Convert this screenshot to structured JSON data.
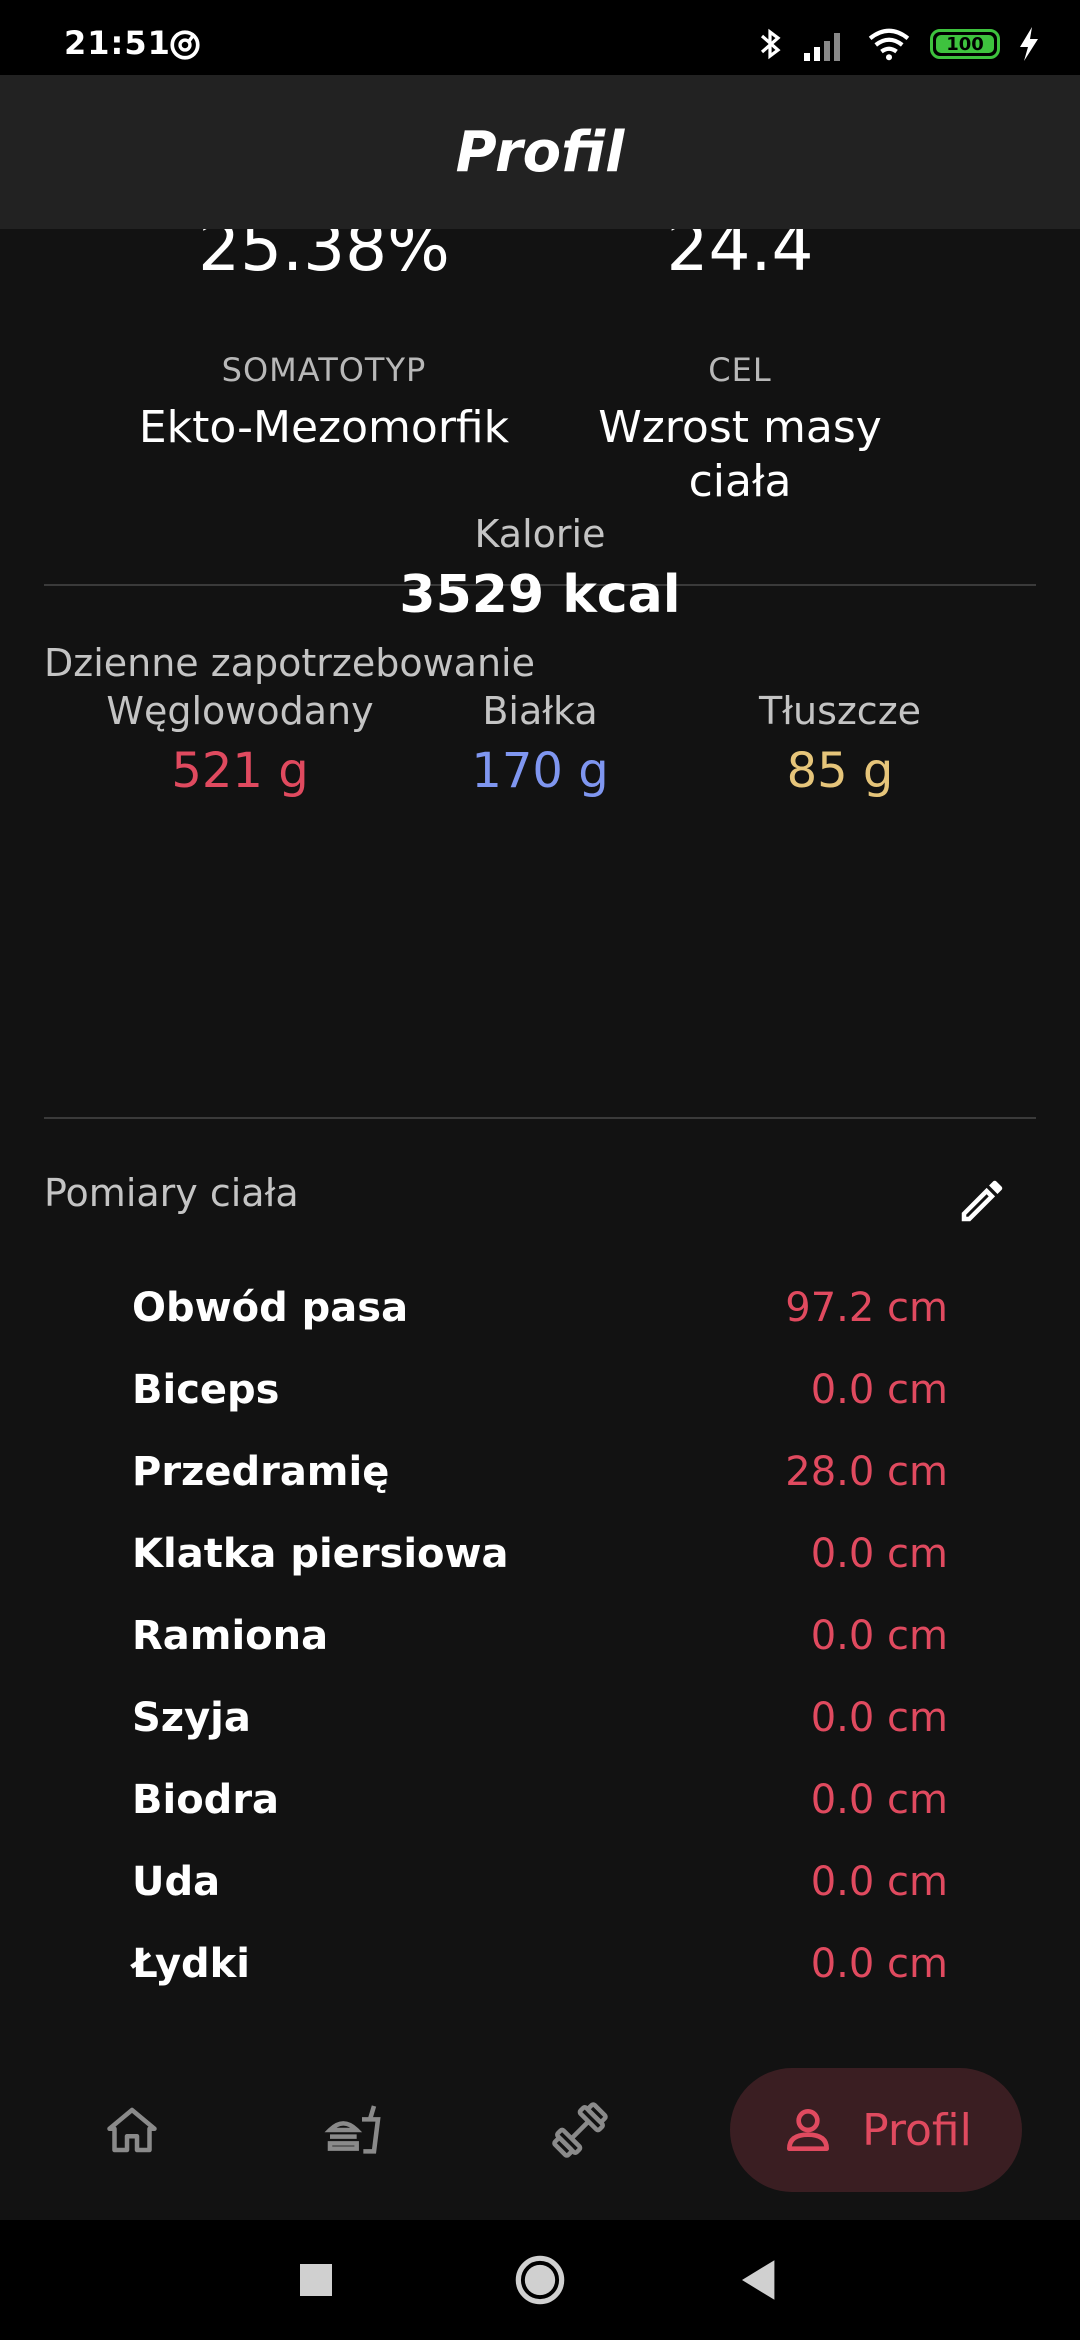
{
  "status_bar": {
    "time": "21:51",
    "battery": "100",
    "icons": [
      "at-icon",
      "bluetooth-icon",
      "signal-icon",
      "wifi-icon",
      "battery-icon",
      "charging-icon"
    ]
  },
  "app_bar": {
    "title": "Profil"
  },
  "stats": {
    "body_fat_value": "25.38%",
    "bmi_value": "24.4",
    "somatotype_label": "SOMATOTYP",
    "somatotype_value": "Ekto-Mezomorfik",
    "goal_label": "CEL",
    "goal_value": "Wzrost masy ciała"
  },
  "daily_needs": {
    "title": "Dzienne zapotrzebowanie",
    "calories_label": "Kalorie",
    "calories_value": "3529 kcal",
    "macros": [
      {
        "label": "Węglowodany",
        "value": "521 g",
        "color": "#e04a5f"
      },
      {
        "label": "Białka",
        "value": "170 g",
        "color": "#7f96f0"
      },
      {
        "label": "Tłuszcze",
        "value": "85 g",
        "color": "#e6c57a"
      }
    ]
  },
  "measurements": {
    "title": "Pomiary ciała",
    "edit_icon": "pencil-icon",
    "value_color": "#e04a5f",
    "rows": [
      {
        "name": "Obwód pasa",
        "value": "97.2 cm"
      },
      {
        "name": "Biceps",
        "value": "0.0 cm"
      },
      {
        "name": "Przedramię",
        "value": "28.0 cm"
      },
      {
        "name": "Klatka piersiowa",
        "value": "0.0 cm"
      },
      {
        "name": "Ramiona",
        "value": "0.0 cm"
      },
      {
        "name": "Szyja",
        "value": "0.0 cm"
      },
      {
        "name": "Biodra",
        "value": "0.0 cm"
      },
      {
        "name": "Uda",
        "value": "0.0 cm"
      },
      {
        "name": "Łydki",
        "value": "0.0 cm"
      }
    ]
  },
  "bottom_nav": {
    "items": [
      {
        "icon": "home-icon"
      },
      {
        "icon": "food-icon"
      },
      {
        "icon": "dumbbell-icon"
      }
    ],
    "active": {
      "icon": "person-icon",
      "label": "Profil"
    }
  },
  "colors": {
    "accent": "#e04a5f",
    "background": "#121212",
    "app_bar": "#222222",
    "active_pill": "#3a1e22"
  }
}
